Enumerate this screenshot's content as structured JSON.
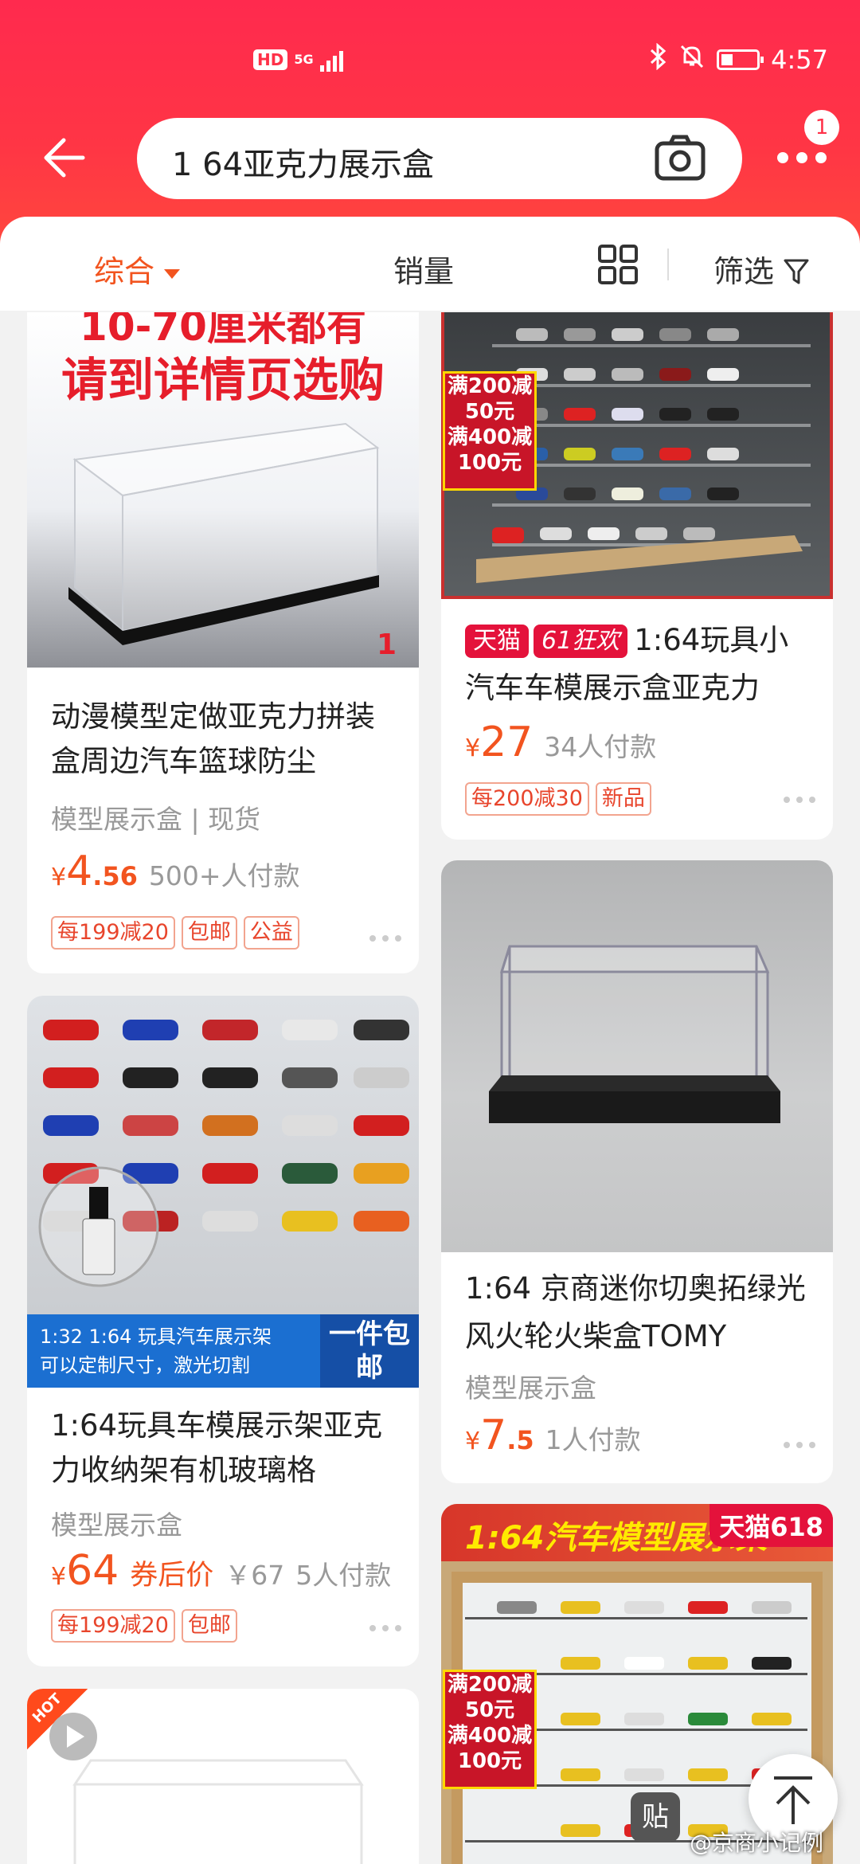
{
  "status_bar": {
    "hd": "HD",
    "network": "5G",
    "time": "4:57"
  },
  "search": {
    "query": "1 64亚克力展示盒",
    "message_count": "1"
  },
  "sort_bar": {
    "comprehensive": "综合",
    "sales": "销量",
    "filter": "筛选"
  },
  "products": [
    {
      "banner_line1": "10-70厘米都有",
      "banner_line2": "请到详情页选购",
      "corner_number": "1",
      "title": "动漫模型定做亚克力拼装盒周边汽车篮球防尘",
      "subtitle": "模型展示盒 | 现货",
      "price_yen": "¥",
      "price_int": "4",
      "price_dec": ".56",
      "sold": "500+人付款",
      "tags": [
        "每199减20",
        "包邮",
        "公益"
      ]
    },
    {
      "badge_tmall": "天猫",
      "badge_sale": "61狂欢",
      "promo": [
        "满200减",
        "50元",
        "满400减",
        "100元"
      ],
      "title": "1:64玩具小汽车车模展示盒亚克力",
      "price_yen": "¥",
      "price_int": "27",
      "sold": "34人付款",
      "tags": [
        "每200减30",
        "新品"
      ]
    },
    {
      "strip_line1": "1:32 1:64 玩具汽车展示架",
      "strip_line2": "可以定制尺寸，激光切割",
      "strip_right": "一件包邮",
      "title": "1:64玩具车模展示架亚克力收纳架有机玻璃格",
      "subtitle": "模型展示盒",
      "price_yen": "¥",
      "price_int": "64",
      "coupon_label": "券后价",
      "orig_price": "￥67",
      "sold": "5人付款",
      "tags": [
        "每199减20",
        "包邮"
      ]
    },
    {
      "title": "1:64 京商迷你切奥拓绿光风火轮火柴盒TOMY",
      "subtitle": "模型展示盒",
      "price_yen": "¥",
      "price_int": "7",
      "price_dec": ".5",
      "sold": "1人付款"
    },
    {
      "hot": "HOT"
    },
    {
      "banner": "1:64汽车模型展示架",
      "badge": "天猫618",
      "promo": [
        "满200减",
        "50元",
        "满400减",
        "100元"
      ]
    }
  ],
  "floating": {
    "paste": "贴",
    "watermark": "@京商小记例"
  },
  "colors": {
    "header": "#ff2d4a",
    "accent": "#f2541f"
  }
}
